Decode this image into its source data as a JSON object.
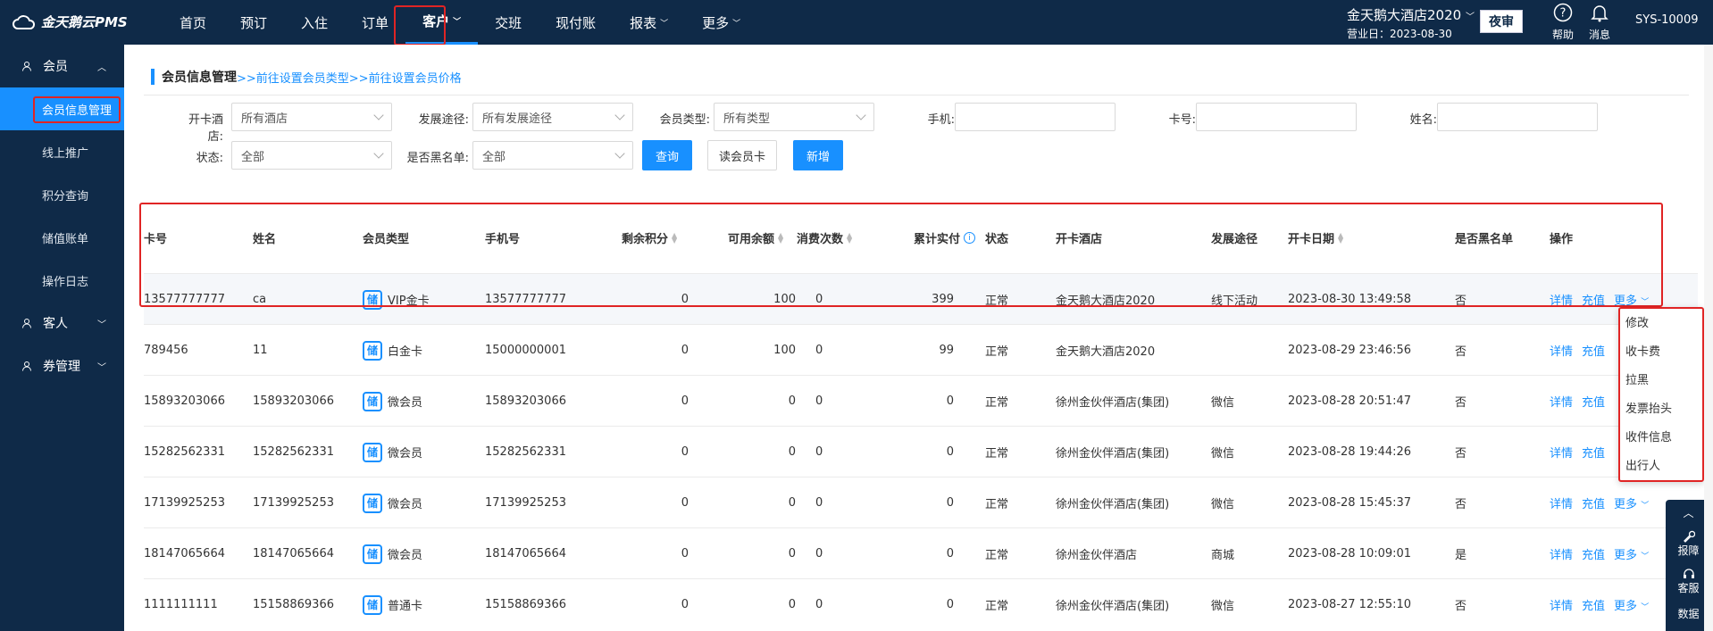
{
  "app": {
    "name": "金天鹅云PMS"
  },
  "nav": {
    "items": [
      {
        "label": "首页"
      },
      {
        "label": "预订"
      },
      {
        "label": "入住"
      },
      {
        "label": "订单"
      },
      {
        "label": "客户"
      },
      {
        "label": "交班"
      },
      {
        "label": "现付账"
      },
      {
        "label": "报表"
      },
      {
        "label": "更多"
      }
    ]
  },
  "hotel": {
    "name": "金天鹅大酒店2020",
    "business_day": "营业日：2023-08-30"
  },
  "top": {
    "night_audit": "夜审",
    "help": "帮助",
    "messages": "消息",
    "user": "SYS-10009"
  },
  "sidebar": {
    "member_group": "会员",
    "member_items": [
      {
        "label": "会员信息管理"
      },
      {
        "label": "线上推广"
      },
      {
        "label": "积分查询"
      },
      {
        "label": "储值账单"
      },
      {
        "label": "操作日志"
      }
    ],
    "guest_group": "客人",
    "coupon_group": "券管理"
  },
  "page": {
    "title": "会员信息管理",
    "links": ">>前往设置会员类型>>前往设置会员价格"
  },
  "filters": {
    "hotel_label": "开卡酒店:",
    "hotel_value": "所有酒店",
    "channel_label": "发展途径:",
    "channel_value": "所有发展途径",
    "type_label": "会员类型:",
    "type_value": "所有类型",
    "phone_label": "手机:",
    "card_label": "卡号:",
    "name_label": "姓名:",
    "status_label": "状态:",
    "status_value": "全部",
    "blacklist_label": "是否黑名单:",
    "blacklist_value": "全部",
    "query_btn": "查询",
    "read_card_btn": "读会员卡",
    "new_btn": "新增"
  },
  "table": {
    "headers": {
      "card": "卡号",
      "name": "姓名",
      "type": "会员类型",
      "phone": "手机号",
      "points": "剩余积分",
      "balance": "可用余额",
      "visits": "消费次数",
      "paid": "累计实付",
      "status": "状态",
      "hotel": "开卡酒店",
      "channel": "发展途径",
      "date": "开卡日期",
      "blacklist": "是否黑名单",
      "ops": "操作"
    },
    "ops": {
      "detail": "详情",
      "recharge": "充值",
      "more": "更多"
    },
    "badge": "储",
    "rows": [
      {
        "card": "13577777777",
        "name": "ca",
        "type": "VIP金卡",
        "phone": "13577777777",
        "points": "0",
        "balance": "100",
        "visits": "0",
        "paid": "399",
        "status": "正常",
        "hotel": "金天鹅大酒店2020",
        "channel": "线下活动",
        "date": "2023-08-30 13:49:58",
        "blacklist": "否"
      },
      {
        "card": "789456",
        "name": "11",
        "type": "白金卡",
        "phone": "15000000001",
        "points": "0",
        "balance": "100",
        "visits": "0",
        "paid": "99",
        "status": "正常",
        "hotel": "金天鹅大酒店2020",
        "channel": "",
        "date": "2023-08-29 23:46:56",
        "blacklist": "否"
      },
      {
        "card": "15893203066",
        "name": "15893203066",
        "type": "微会员",
        "phone": "15893203066",
        "points": "0",
        "balance": "0",
        "visits": "0",
        "paid": "0",
        "status": "正常",
        "hotel": "徐州金伙伴酒店(集团)",
        "channel": "微信",
        "date": "2023-08-28 20:51:47",
        "blacklist": "否"
      },
      {
        "card": "15282562331",
        "name": "15282562331",
        "type": "微会员",
        "phone": "15282562331",
        "points": "0",
        "balance": "0",
        "visits": "0",
        "paid": "0",
        "status": "正常",
        "hotel": "徐州金伙伴酒店(集团)",
        "channel": "微信",
        "date": "2023-08-28 19:44:26",
        "blacklist": "否"
      },
      {
        "card": "17139925253",
        "name": "17139925253",
        "type": "微会员",
        "phone": "17139925253",
        "points": "0",
        "balance": "0",
        "visits": "0",
        "paid": "0",
        "status": "正常",
        "hotel": "徐州金伙伴酒店(集团)",
        "channel": "微信",
        "date": "2023-08-28 15:45:37",
        "blacklist": "否"
      },
      {
        "card": "18147065664",
        "name": "18147065664",
        "type": "微会员",
        "phone": "18147065664",
        "points": "0",
        "balance": "0",
        "visits": "0",
        "paid": "0",
        "status": "正常",
        "hotel": "徐州金伙伴酒店",
        "channel": "商城",
        "date": "2023-08-28 10:09:01",
        "blacklist": "是"
      },
      {
        "card": "1111111111",
        "name": "15158869366",
        "type": "普通卡",
        "phone": "15158869366",
        "points": "0",
        "balance": "0",
        "visits": "0",
        "paid": "0",
        "status": "正常",
        "hotel": "徐州金伙伴酒店(集团)",
        "channel": "微信",
        "date": "2023-08-27 12:55:10",
        "blacklist": "否"
      }
    ]
  },
  "more_menu": [
    "修改",
    "收卡费",
    "拉黑",
    "发票抬头",
    "收件信息",
    "出行人"
  ],
  "float_panel": {
    "report": "报障",
    "service": "客服",
    "data": "数据"
  },
  "colors": {
    "nav_bg": "#0f2a48",
    "accent": "#1890ff",
    "highlight_box": "#e02424"
  }
}
